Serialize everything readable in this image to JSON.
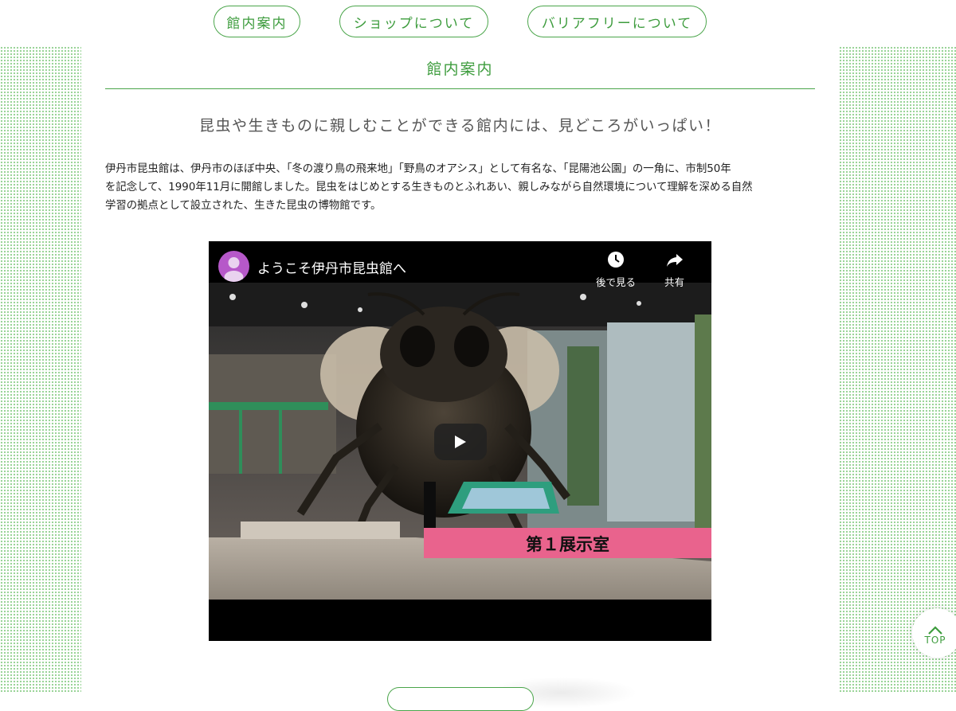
{
  "nav": {
    "items": [
      {
        "label": "館内案内"
      },
      {
        "label": "ショップについて"
      },
      {
        "label": "バリアフリーについて"
      }
    ]
  },
  "section": {
    "title": "館内案内",
    "subtitle": "昆虫や生きものに親しむことができる館内には、見どころがいっぱい！",
    "body_lines": [
      "伊丹市昆虫館は、伊丹市のほぼ中央、「冬の渡り鳥の飛来地」「野鳥のオアシス」として有名な、「昆陽池公園」の一角に、市制50年",
      "を記念して、1990年11月に開館しました。昆虫をはじめとする生きものとふれあい、親しみながら自然環境について理解を深める自然",
      "学習の拠点として設立された、生きた昆虫の博物館です。"
    ]
  },
  "video": {
    "title": "ようこそ伊丹市昆虫館へ",
    "watch_later_label": "後で見る",
    "share_label": "共有",
    "caption": "第１展示室",
    "icons": [
      "avatar",
      "clock-icon",
      "share-icon",
      "play-icon"
    ]
  },
  "page_top": {
    "label": "TOP",
    "icon": "chevron-up-icon"
  },
  "colors": {
    "accent": "#3d9c3d",
    "dots": "#8fcf8c",
    "video_bg": "#000000",
    "caption_bar": "#e9638d"
  }
}
